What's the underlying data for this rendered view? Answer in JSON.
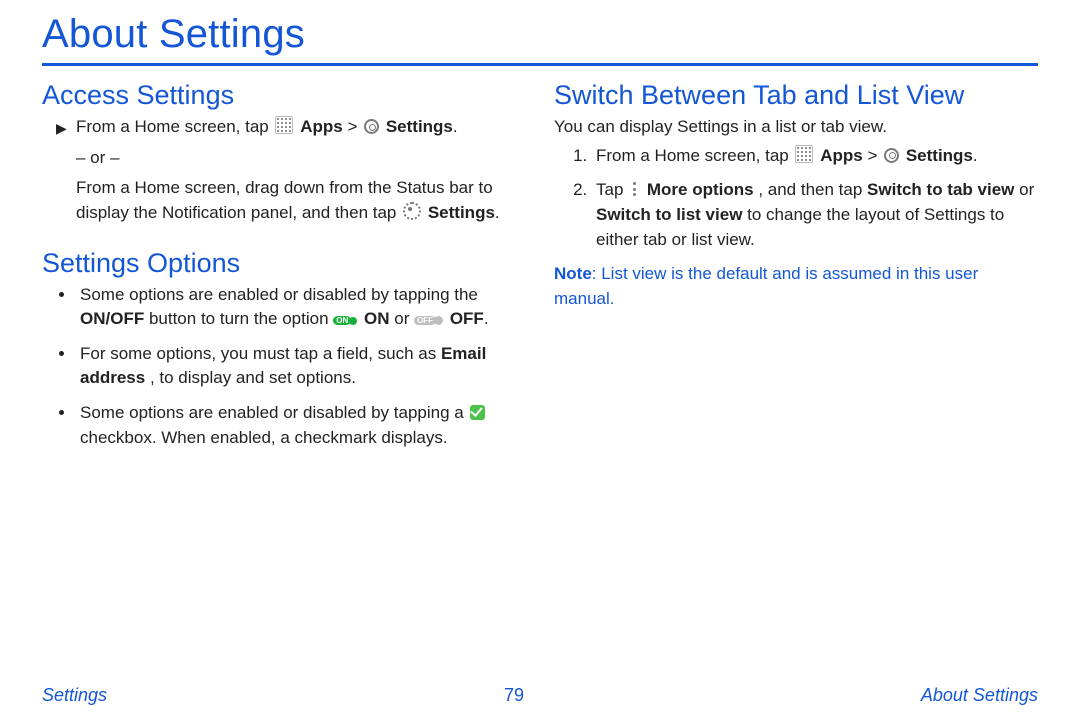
{
  "title": "About Settings",
  "left": {
    "access": {
      "heading": "Access Settings",
      "line1_a": "From a Home screen, tap ",
      "apps_label": "Apps",
      "gt": " > ",
      "settings_label": "Settings",
      "period": ".",
      "or": "– or –",
      "line2_a": "From a Home screen, drag down from the Status bar to display the Notification panel, and then tap ",
      "settings_label2": "Settings"
    },
    "options": {
      "heading": "Settings Options",
      "b1_a": "Some options are enabled or disabled by tapping the ",
      "onoff": "ON/OFF",
      "b1_b": " button to turn the option ",
      "on": "ON",
      "b1_c": " or ",
      "off": "OFF",
      "b2_a": "For some options, you must tap a field, such as ",
      "email": "Email address",
      "b2_b": ", to display and set options.",
      "b3_a": "Some options are enabled or disabled by tapping a ",
      "b3_b": " checkbox. When enabled, a checkmark displays."
    }
  },
  "right": {
    "heading": "Switch Between Tab and List View",
    "intro": "You can display Settings in a list or tab view.",
    "s1_a": "From a Home screen, tap ",
    "apps_label": "Apps",
    "gt": " > ",
    "settings_label": "Settings",
    "period": ".",
    "s2_a": "Tap ",
    "more": "More options",
    "s2_b": ", and then tap ",
    "switch_tab": "Switch to tab view",
    "s2_c": " or ",
    "switch_list": "Switch to list view",
    "s2_d": " to change the layout of Settings to either tab or list view.",
    "note_label": "Note",
    "note_text": ": List view is the default and is assumed in this user manual."
  },
  "footer": {
    "left": "Settings",
    "center": "79",
    "right": "About Settings"
  },
  "icons": {
    "on_pill": "ON",
    "off_pill": "OFF"
  }
}
